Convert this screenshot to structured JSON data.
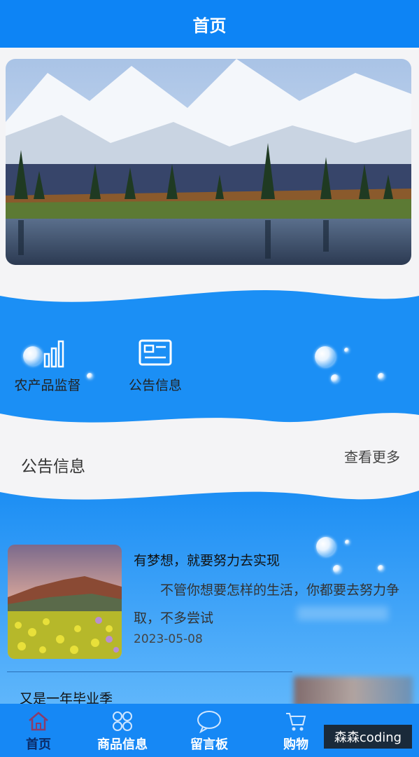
{
  "header": {
    "title": "首页"
  },
  "quick_nav": [
    {
      "label": "农产品监督",
      "icon": "bar-chart-icon"
    },
    {
      "label": "公告信息",
      "icon": "news-card-icon"
    }
  ],
  "section": {
    "title": "公告信息",
    "more": "查看更多"
  },
  "news": [
    {
      "title": "有梦想，就要努力去实现",
      "excerpt": "不管你想要怎样的生活，你都要去努力争取，不多尝试",
      "date": "2023-05-08"
    },
    {
      "title": "又是一年毕业季"
    }
  ],
  "tabbar": {
    "items": [
      {
        "label": "首页",
        "icon": "home-icon",
        "active": true
      },
      {
        "label": "商品信息",
        "icon": "grid-icon"
      },
      {
        "label": "留言板",
        "icon": "chat-icon"
      },
      {
        "label": "购物",
        "icon": "cart-icon"
      }
    ]
  },
  "watermark": "森森coding",
  "colors": {
    "primary": "#0d84f5",
    "wave": "#1b8ff5",
    "background": "#f4f4f6"
  }
}
